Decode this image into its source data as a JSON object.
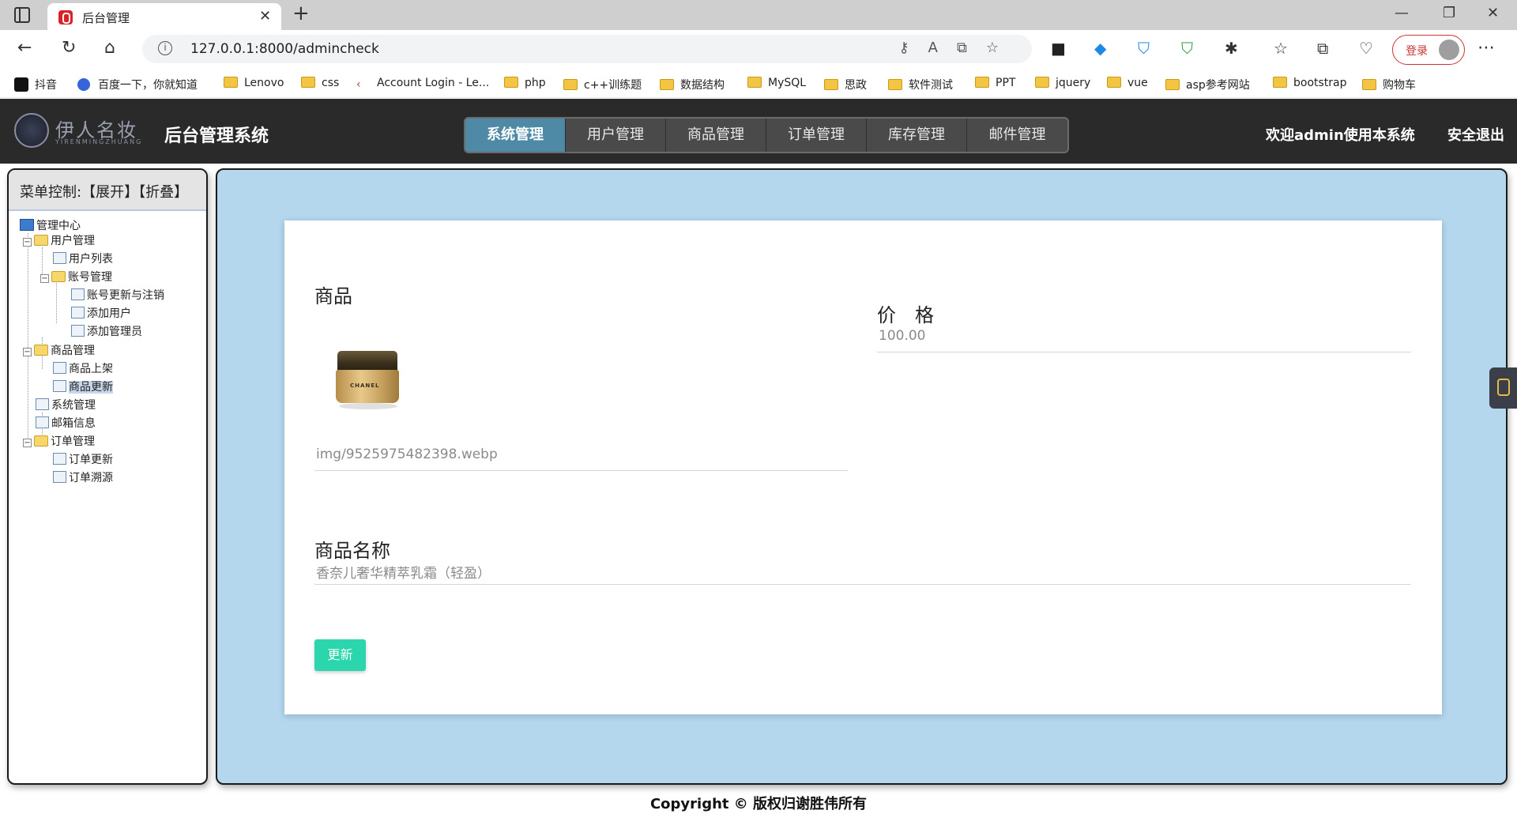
{
  "browser": {
    "tab_title": "后台管理",
    "url": "127.0.0.1:8000/admincheck",
    "login_label": "登录",
    "bookmarks": [
      {
        "label": "抖音",
        "icon": "tiktok-icon"
      },
      {
        "label": "百度一下，你就知道",
        "icon": "baidu-icon"
      },
      {
        "label": "Lenovo",
        "icon": "folder-icon"
      },
      {
        "label": "css",
        "icon": "folder-icon"
      },
      {
        "label": "Account Login - Le...",
        "icon": "account-icon"
      },
      {
        "label": "php",
        "icon": "folder-icon"
      },
      {
        "label": "c++训练题",
        "icon": "folder-icon"
      },
      {
        "label": "数据结构",
        "icon": "folder-icon"
      },
      {
        "label": "MySQL",
        "icon": "folder-icon"
      },
      {
        "label": "思政",
        "icon": "folder-icon"
      },
      {
        "label": "软件测试",
        "icon": "folder-icon"
      },
      {
        "label": "PPT",
        "icon": "folder-icon"
      },
      {
        "label": "jquery",
        "icon": "folder-icon"
      },
      {
        "label": "vue",
        "icon": "folder-icon"
      },
      {
        "label": "asp参考网站",
        "icon": "folder-icon"
      },
      {
        "label": "bootstrap",
        "icon": "folder-icon"
      },
      {
        "label": "购物车",
        "icon": "folder-icon"
      }
    ]
  },
  "header": {
    "logo_cn": "伊人名妆",
    "logo_en": "YIRENMINGZHUANG",
    "title": "后台管理系统",
    "menu": [
      "系统管理",
      "用户管理",
      "商品管理",
      "订单管理",
      "库存管理",
      "邮件管理"
    ],
    "active_menu": "系统管理",
    "welcome": "欢迎admin使用本系统",
    "logout": "安全退出"
  },
  "sidebar": {
    "control_label": "菜单控制:【展开】【折叠】",
    "tree": {
      "root": "管理中心",
      "user_mgmt": "用户管理",
      "user_list": "用户列表",
      "account_mgmt": "账号管理",
      "account_update": "账号更新与注销",
      "add_user": "添加用户",
      "add_admin": "添加管理员",
      "product_mgmt": "商品管理",
      "product_list": "商品上架",
      "product_update": "商品更新",
      "system_mgmt": "系统管理",
      "mail_info": "邮箱信息",
      "order_mgmt": "订单管理",
      "order_update": "订单更新",
      "order_trace": "订单溯源"
    },
    "selected": "商品更新"
  },
  "form": {
    "product_label": "商品",
    "product_image_path": "img/9525975482398.webp",
    "product_image_brand": "CHANEL",
    "price_label": "价　格",
    "price_value": "100.00",
    "name_label": "商品名称",
    "name_value": "香奈儿奢华精萃乳霜（轻盈）",
    "submit_label": "更新"
  },
  "footer": {
    "copyright": "Copyright © 版权归谢胜伟所有"
  },
  "colors": {
    "header_bg": "#2a2a2a",
    "menu_active": "#4e8aa6",
    "content_bg": "#b4d7ee",
    "button": "#2cd6ad"
  }
}
